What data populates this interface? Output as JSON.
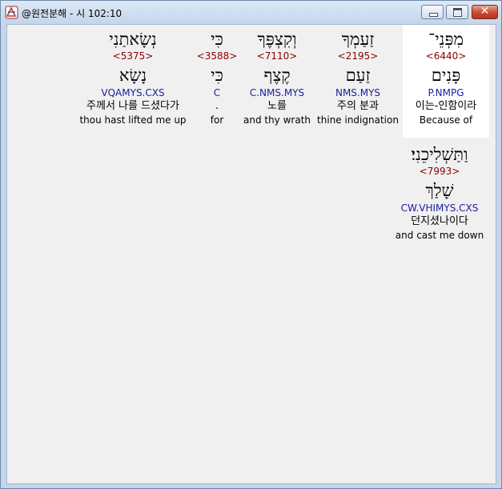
{
  "window": {
    "title": "@원전분해 - 시 102:10",
    "close_glyph": "✕"
  },
  "words": [
    {
      "hebrew": "מִפְּנֵי־",
      "strong": "<6440>",
      "root": "פָּנִים",
      "parse": "P.NMPG",
      "korean": "이는-인함이라",
      "english": "Because of",
      "selected": true
    },
    {
      "hebrew": "זַעַמְךָ",
      "strong": "<2195>",
      "root": "זַעַם",
      "parse": "NMS.MYS",
      "korean": "주의 분과",
      "english": "thine indignation",
      "selected": false
    },
    {
      "hebrew": "וְקִצְפֶּךָ",
      "strong": "<7110>",
      "root": "קֶצֶף",
      "parse": "C.NMS.MYS",
      "korean": "노를",
      "english": "and thy wrath",
      "selected": false
    },
    {
      "hebrew": "כִּי",
      "strong": "<3588>",
      "root": "כִּי",
      "parse": "C",
      "korean": ".",
      "english": "for",
      "selected": false
    },
    {
      "hebrew": "נְשָׂאתַנִי",
      "strong": "<5375>",
      "root": "נָשָׂא",
      "parse": "VQAMYS.CXS",
      "korean": "주께서 나를 드셨다가",
      "english": "thou hast lifted me up",
      "selected": false
    },
    {
      "hebrew": "וַתַּשְׁלִיכֵנִי׃",
      "strong": "<7993>",
      "root": "שָׁלַךְ",
      "parse": "CW.VHIMYS.CXS",
      "korean": "던지셨나이다",
      "english": "and cast me down",
      "selected": false
    }
  ]
}
